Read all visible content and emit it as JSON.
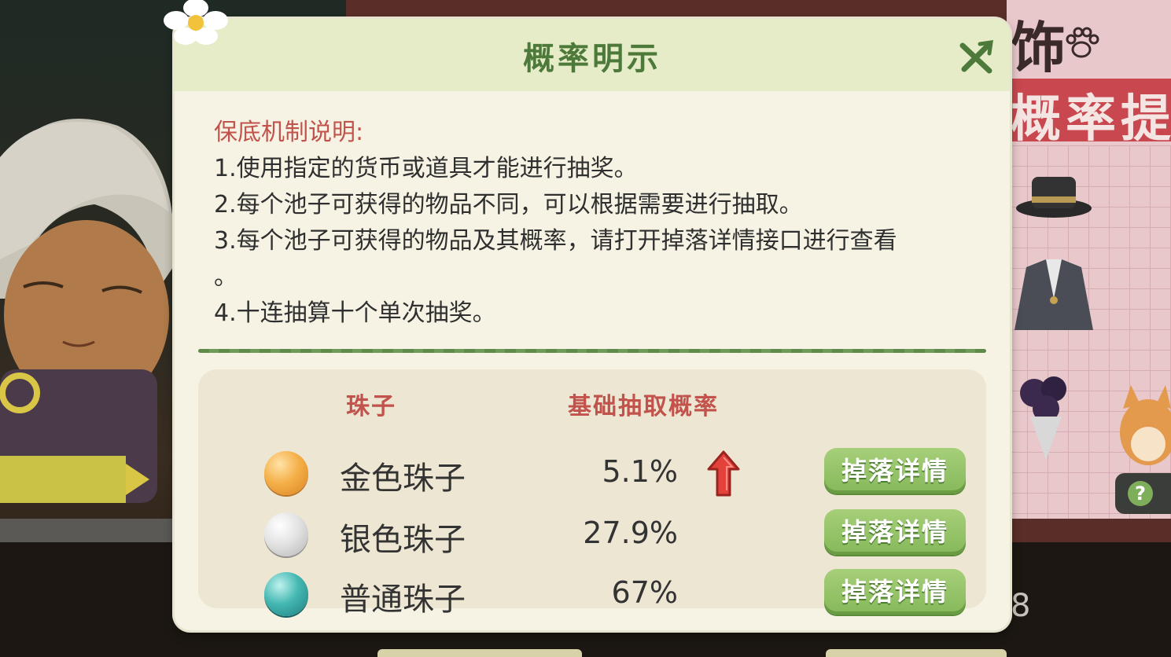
{
  "dialog": {
    "title": "概率明示",
    "close_icon": "close-x-icon",
    "rules": {
      "heading": "保底机制说明:",
      "lines": [
        "1.使用指定的货币或道具才能进行抽奖。",
        "2.每个池子可获得的物品不同，可以根据需要进行抽取。",
        "3.每个池子可获得的物品及其概率，请打开掉落详情接口进行查看",
        "。",
        "4.十连抽算十个单次抽奖。"
      ]
    },
    "table": {
      "col_bead": "珠子",
      "col_rate": "基础抽取概率",
      "rows": [
        {
          "name": "金色珠子",
          "rate": "5.1%",
          "color": "#f0a53a",
          "boosted": true,
          "button": "掉落详情"
        },
        {
          "name": "银色珠子",
          "rate": "27.9%",
          "color": "#d7d7d7",
          "boosted": false,
          "button": "掉落详情"
        },
        {
          "name": "普通珠子",
          "rate": "67%",
          "color": "#3aaeae",
          "boosted": false,
          "button": "掉落详情"
        }
      ]
    }
  },
  "background": {
    "banner_text": "概率提",
    "top_text": "饰",
    "counter_number": "8",
    "help_symbol": "?"
  },
  "colors": {
    "title_green": "#4d7a3b",
    "accent_red": "#c2534c",
    "button_green": "#86b85a"
  }
}
